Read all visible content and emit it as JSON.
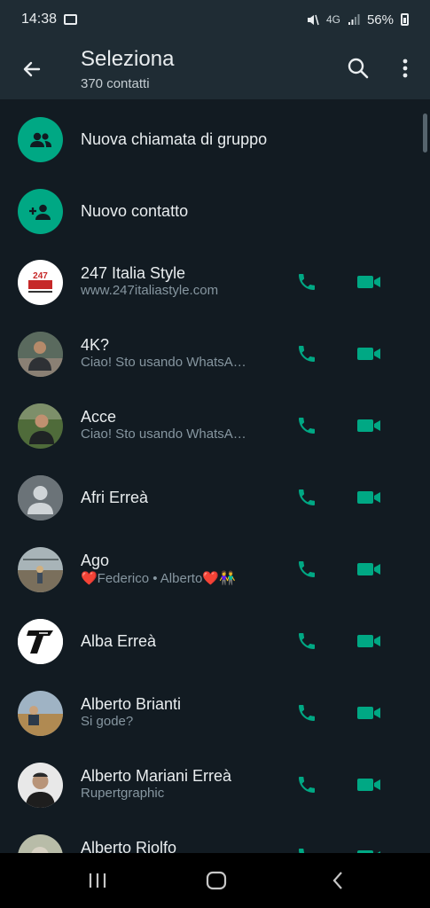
{
  "status_bar": {
    "time": "14:38",
    "network": "4G",
    "battery": "56%"
  },
  "header": {
    "title": "Seleziona",
    "subtitle": "370 contatti"
  },
  "actions": [
    {
      "label": "Nuova chiamata di gruppo",
      "icon": "group-icon"
    },
    {
      "label": "Nuovo contatto",
      "icon": "add-contact-icon"
    }
  ],
  "contacts": [
    {
      "name": "247 Italia Style",
      "status": "www.247italiastyle.com"
    },
    {
      "name": "4K?",
      "status": "Ciao! Sto usando WhatsA…"
    },
    {
      "name": "Acce",
      "status": "Ciao! Sto usando WhatsA…"
    },
    {
      "name": "Afri Erreà",
      "status": ""
    },
    {
      "name": "Ago",
      "status": "❤️Federico • Alberto❤️👫"
    },
    {
      "name": "Alba Erreà",
      "status": ""
    },
    {
      "name": "Alberto Brianti",
      "status": "Si gode?"
    },
    {
      "name": "Alberto Mariani Erreà",
      "status": "Rupertgraphic"
    },
    {
      "name": "Alberto Riolfo",
      "status": ""
    }
  ],
  "avatar_logo_text": "247",
  "colors": {
    "accent": "#00a884",
    "background": "#121b22",
    "app_bar": "#1f2c34",
    "primary_text": "#e9edef",
    "secondary_text": "#8696a0"
  }
}
